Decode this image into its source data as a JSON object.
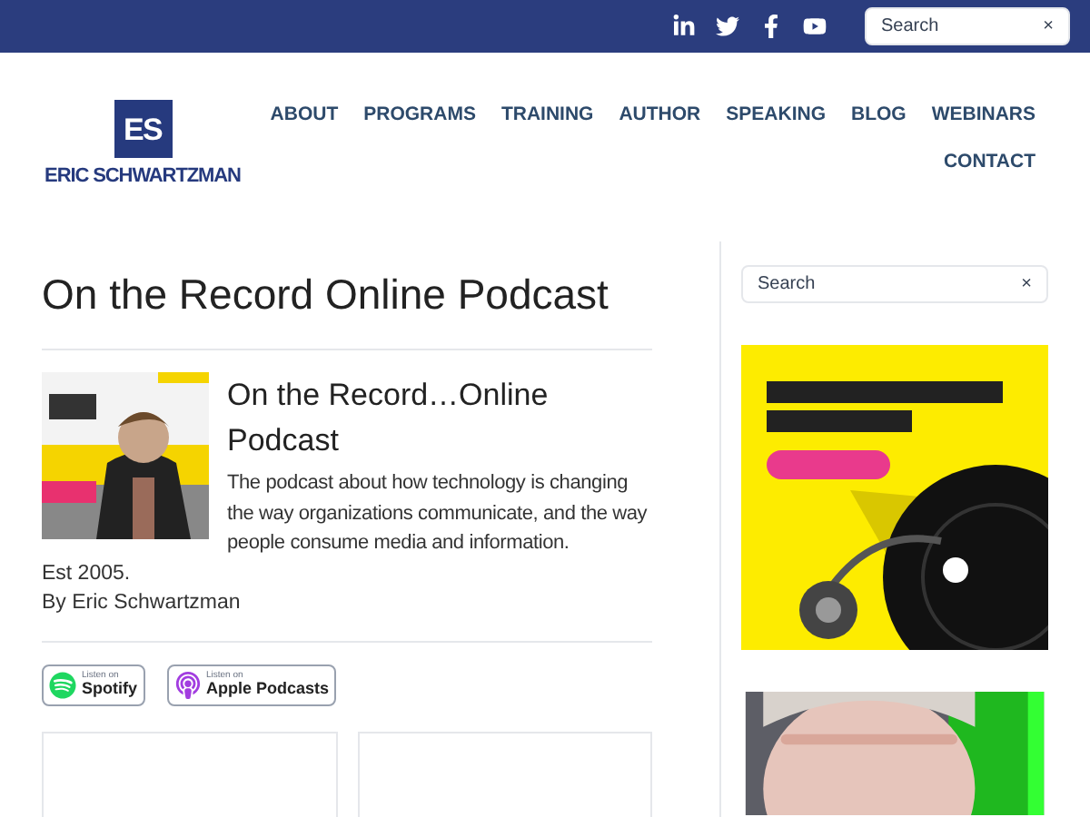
{
  "top_bar": {
    "social": [
      {
        "kind": "linkedin"
      },
      {
        "kind": "twitter"
      },
      {
        "kind": "facebook"
      },
      {
        "kind": "youtube"
      }
    ],
    "search": {
      "placeholder": "Search",
      "clear": "×"
    }
  },
  "logo": {
    "mark": "ES",
    "name": "ERIC SCHWARTZMAN"
  },
  "nav": [
    "ABOUT",
    "PROGRAMS",
    "TRAINING",
    "AUTHOR",
    "SPEAKING",
    "BLOG",
    "WEBINARS",
    "CONTACT"
  ],
  "page_title": "On the Record Online Podcast",
  "podcast": {
    "title": "On the Record…Online Podcast",
    "description": "The podcast about how technology is changing the way organizations communicate, and the way people consume media and information.",
    "established": "Est 2005.",
    "byline": "By Eric Schwartzman"
  },
  "badges": [
    {
      "kind": "spotify",
      "small": "Listen on",
      "name": "Spotify"
    },
    {
      "kind": "apple",
      "small": "Listen on",
      "name": "Apple Podcasts"
    }
  ],
  "sidebar": {
    "search": {
      "placeholder": "Search",
      "clear": "×"
    }
  }
}
